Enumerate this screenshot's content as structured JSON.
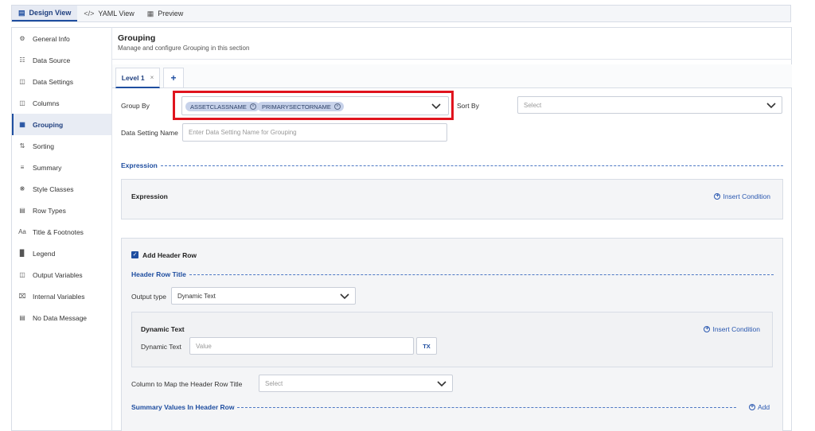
{
  "view_tabs": [
    {
      "label": "Design View",
      "icon": "document-icon",
      "active": true
    },
    {
      "label": "YAML View",
      "icon": "code-icon",
      "active": false
    },
    {
      "label": "Preview",
      "icon": "preview-icon",
      "active": false
    }
  ],
  "sidebar": {
    "items": [
      {
        "label": "General Info",
        "icon": "gear-icon"
      },
      {
        "label": "Data Source",
        "icon": "database-icon"
      },
      {
        "label": "Data Settings",
        "icon": "data-settings-icon"
      },
      {
        "label": "Columns",
        "icon": "columns-icon"
      },
      {
        "label": "Grouping",
        "icon": "grouping-icon",
        "active": true
      },
      {
        "label": "Sorting",
        "icon": "sort-icon"
      },
      {
        "label": "Summary",
        "icon": "list-icon"
      },
      {
        "label": "Style Classes",
        "icon": "palette-icon"
      },
      {
        "label": "Row Types",
        "icon": "row-types-icon"
      },
      {
        "label": "Title & Footnotes",
        "icon": "text-icon"
      },
      {
        "label": "Legend",
        "icon": "legend-icon"
      },
      {
        "label": "Output Variables",
        "icon": "output-icon"
      },
      {
        "label": "Internal Variables",
        "icon": "variables-icon"
      },
      {
        "label": "No Data Message",
        "icon": "message-icon"
      }
    ]
  },
  "main": {
    "title": "Grouping",
    "subtitle": "Manage and configure Grouping in this section",
    "level_tab": {
      "label": "Level 1",
      "close": "×"
    },
    "add_level": "+",
    "group_by": {
      "label": "Group By",
      "chips": [
        "ASSETCLASSNAME",
        "PRIMARYSECTORNAME"
      ]
    },
    "sort_by": {
      "label": "Sort By",
      "placeholder": "Select"
    },
    "data_setting_name": {
      "label": "Data Setting Name",
      "placeholder": "Enter Data Setting Name for Grouping"
    },
    "expression_section": "Expression",
    "expression_box": {
      "title": "Expression",
      "insert": "Insert Condition"
    },
    "header_row": {
      "checkbox_label": "Add Header Row",
      "section_title": "Header Row Title",
      "output_type": {
        "label": "Output type",
        "value": "Dynamic Text"
      },
      "dynamic_box": {
        "title": "Dynamic Text",
        "insert": "Insert Condition",
        "field_label": "Dynamic Text",
        "field_placeholder": "Value",
        "tx_button": "TX"
      },
      "column_map": {
        "label": "Column to Map the Header Row Title",
        "placeholder": "Select"
      },
      "summary_section": "Summary Values In Header Row",
      "add": "Add"
    }
  }
}
